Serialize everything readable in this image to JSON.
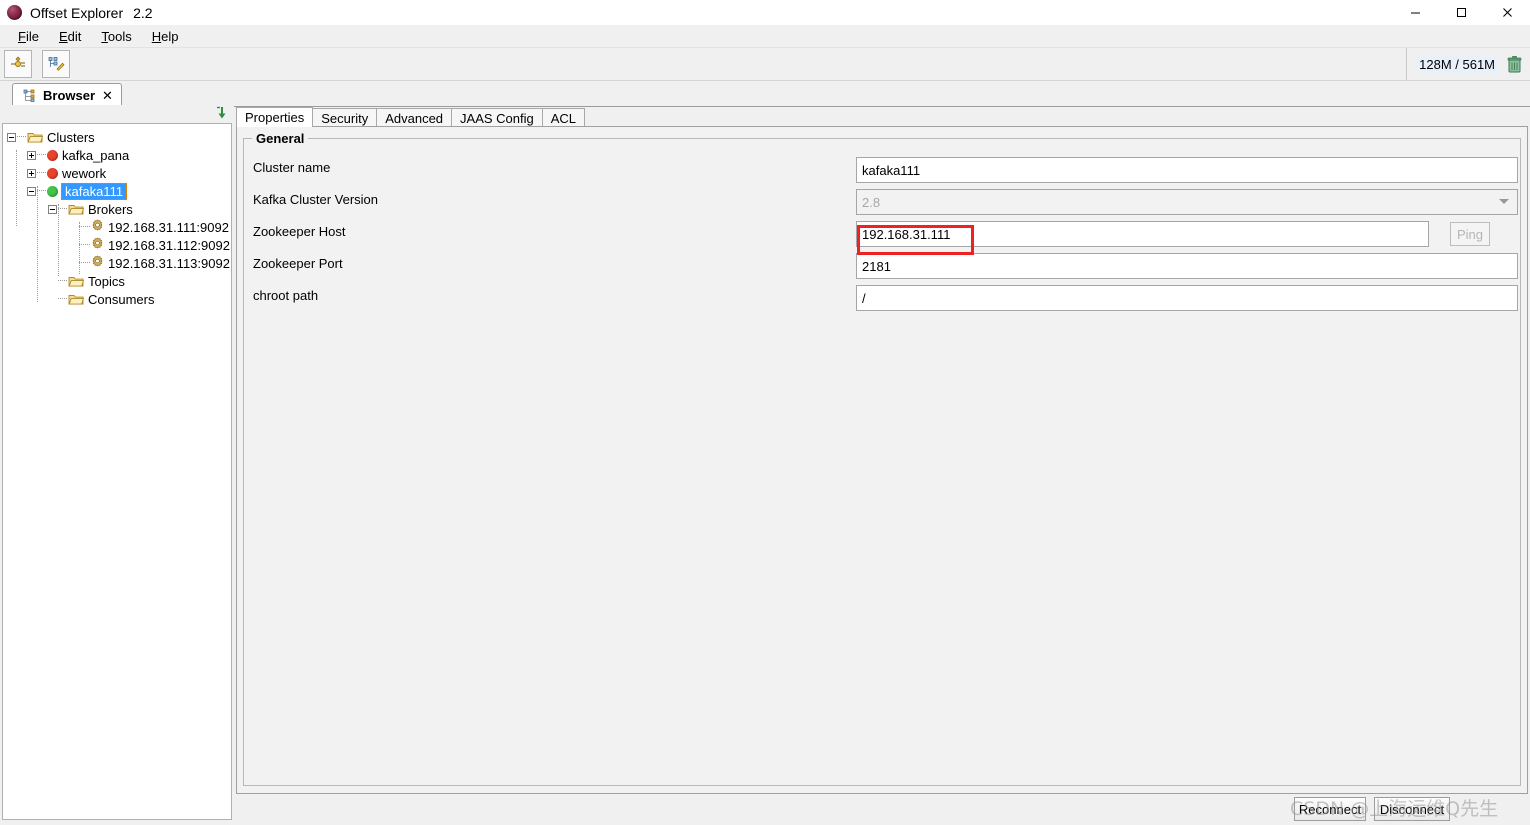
{
  "window": {
    "title": "Offset Explorer",
    "version": "2.2",
    "app_icon": "sphere-logo-icon",
    "controls": {
      "minimize": "minimize-icon",
      "maximize": "maximize-icon",
      "close": "close-icon"
    }
  },
  "menu": {
    "items": [
      {
        "label": "File",
        "mnemonic": "F"
      },
      {
        "label": "Edit",
        "mnemonic": "E"
      },
      {
        "label": "Tools",
        "mnemonic": "T"
      },
      {
        "label": "Help",
        "mnemonic": "H"
      }
    ]
  },
  "toolbar": {
    "buttons": [
      {
        "name": "add-cluster-button",
        "icon": "connection-settings-icon"
      },
      {
        "name": "edit-cluster-button",
        "icon": "tree-edit-icon"
      }
    ],
    "memory": {
      "text": "128M / 561M",
      "used": "128M",
      "total": "561M",
      "gc_icon": "trash-icon"
    }
  },
  "tabstrip": {
    "browser_tab": {
      "label": "Browser",
      "icon": "tree-browser-icon",
      "close": "✕"
    }
  },
  "tree": {
    "header_icon": "collapse-all-down-arrow-icon",
    "nodes": [
      {
        "label": "Clusters",
        "depth": 0,
        "expander": "minus",
        "icon": "folder-icon"
      },
      {
        "label": "kafka_pana",
        "depth": 1,
        "expander": "plus",
        "icon": "status-dot",
        "status_color": "#e8432c"
      },
      {
        "label": "wework",
        "depth": 1,
        "expander": "plus",
        "icon": "status-dot",
        "status_color": "#e8432c"
      },
      {
        "label": "kafaka111",
        "depth": 1,
        "expander": "minus",
        "icon": "status-dot",
        "status_color": "#44c44a",
        "selected": true
      },
      {
        "label": "Brokers",
        "depth": 2,
        "expander": "minus",
        "icon": "folder-icon"
      },
      {
        "label": "192.168.31.111:9092",
        "depth": 3,
        "expander": "none",
        "icon": "gear-icon"
      },
      {
        "label": "192.168.31.112:9092",
        "depth": 3,
        "expander": "none",
        "icon": "gear-icon"
      },
      {
        "label": "192.168.31.113:9092",
        "depth": 3,
        "expander": "none",
        "icon": "gear-icon"
      },
      {
        "label": "Topics",
        "depth": 2,
        "expander": "none",
        "icon": "folder-icon"
      },
      {
        "label": "Consumers",
        "depth": 2,
        "expander": "none",
        "icon": "folder-icon"
      }
    ]
  },
  "content": {
    "tabs": [
      {
        "label": "Properties",
        "active": true
      },
      {
        "label": "Security",
        "active": false
      },
      {
        "label": "Advanced",
        "active": false
      },
      {
        "label": "JAAS Config",
        "active": false
      },
      {
        "label": "ACL",
        "active": false
      }
    ],
    "group_title": "General",
    "fields": [
      {
        "label": "Cluster name",
        "value": "kafaka111",
        "type": "text",
        "name": "cluster-name",
        "disabled": false,
        "highlighted": false
      },
      {
        "label": "Kafka Cluster Version",
        "value": "2.8",
        "type": "combo",
        "name": "kafka-cluster-version",
        "disabled": true,
        "highlighted": false
      },
      {
        "label": "Zookeeper Host",
        "value": "192.168.31.111",
        "type": "text",
        "name": "zookeeper-host",
        "disabled": false,
        "highlighted": true
      },
      {
        "label": "Zookeeper Port",
        "value": "2181",
        "type": "text",
        "name": "zookeeper-port",
        "disabled": false,
        "highlighted": false
      },
      {
        "label": "chroot path",
        "value": "/",
        "type": "text",
        "name": "chroot-path",
        "disabled": false,
        "highlighted": false
      }
    ],
    "ping_button": {
      "label": "Ping",
      "disabled": true
    }
  },
  "footer": {
    "buttons": [
      {
        "label": "Reconnect",
        "name": "reconnect-button"
      },
      {
        "label": "Disconnect",
        "name": "disconnect-button"
      }
    ]
  },
  "watermark": {
    "text": "CSDN @上海运维Q先生"
  },
  "colors": {
    "accent_highlight": "#3399ff",
    "annotation_red": "#ee2222",
    "status_connected": "#44c44a",
    "status_disconnected": "#e8432c",
    "panel_bg": "#f0f0f0"
  }
}
